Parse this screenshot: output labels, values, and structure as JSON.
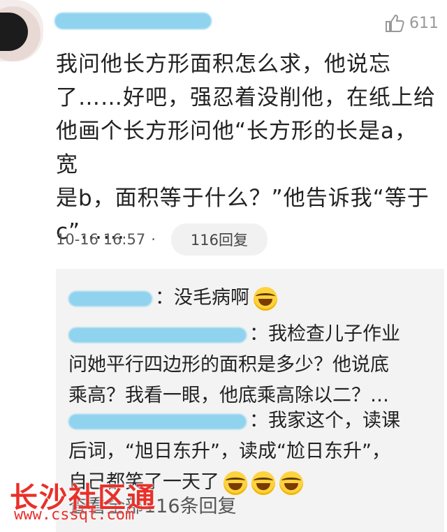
{
  "comment": {
    "likes": "611",
    "text_lines": [
      "我问他长方形面积怎么求，他说忘",
      "了……好吧，强忍着没削他，在纸上给",
      "他画个长方形问他“长方形的长是a，宽",
      "是b，面积等于什么？”他告诉我“等于",
      "c”……"
    ],
    "timestamp": "10-16 16:57",
    "separator": "·",
    "reply_count_label": "116回复"
  },
  "replies": [
    {
      "text": "：没毛病啊"
    },
    {
      "lines": [
        "：我检查儿子作业",
        "问她平行四边形的面积是多少？他说底",
        "乘高？我看一眼，他底乘高除以二？…"
      ]
    },
    {
      "lines": [
        "：我家这个，读课",
        "后词，“旭日东升”，读成“尬日东升”，",
        "自己都笑了一天了"
      ]
    }
  ],
  "view_all": "查看全部116条回复",
  "watermark": {
    "title": "长沙社区通",
    "url": "www.cssqt.com"
  },
  "icons": {
    "like": "thumbs-up-icon",
    "laugh": "laughing-emoji-icon"
  }
}
